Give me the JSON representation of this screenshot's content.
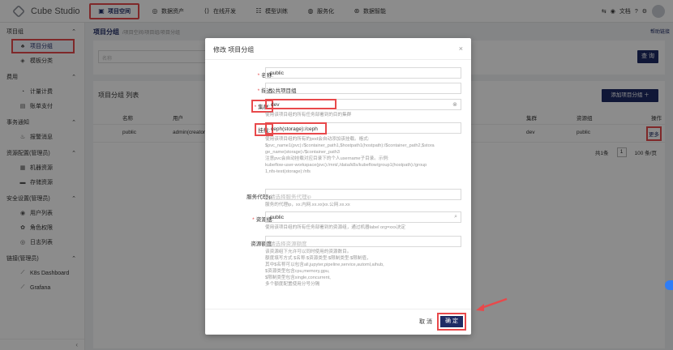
{
  "app": {
    "name": "Cube Studio"
  },
  "nav": [
    {
      "label": "项目空间",
      "icon": "briefcase-icon",
      "active": true
    },
    {
      "label": "数据资产",
      "icon": "database-icon"
    },
    {
      "label": "在线开发",
      "icon": "code-icon"
    },
    {
      "label": "模型训练",
      "icon": "model-icon"
    },
    {
      "label": "服务化",
      "icon": "service-icon"
    },
    {
      "label": "数据智能",
      "icon": "ai-icon"
    }
  ],
  "header_right": {
    "lang": "文档",
    "help": "?"
  },
  "sidebar": {
    "groups": [
      {
        "label": "项目组",
        "items": [
          {
            "label": "项目分组",
            "active": true
          },
          {
            "label": "模板分类"
          }
        ]
      },
      {
        "label": "费用",
        "items": [
          {
            "label": "计量计费"
          },
          {
            "label": "账单支付"
          }
        ]
      },
      {
        "label": "事务通知",
        "items": [
          {
            "label": "报警消息"
          }
        ]
      },
      {
        "label": "资源配置(管理员)",
        "items": [
          {
            "label": "机器资源"
          },
          {
            "label": "存储资源"
          }
        ]
      },
      {
        "label": "安全设置(管理员)",
        "items": [
          {
            "label": "用户列表"
          },
          {
            "label": "角色权限"
          },
          {
            "label": "日志列表"
          }
        ]
      },
      {
        "label": "链接(管理员)",
        "items": [
          {
            "label": "K8s Dashboard"
          },
          {
            "label": "Grafana"
          }
        ]
      }
    ],
    "collapse": "‹"
  },
  "page": {
    "breadcrumb": "项目分组",
    "breadcrumb_sub": "/项目空间/项目组/项目分组",
    "help_link": "帮助链接",
    "search_placeholder": "名称",
    "search_button": "查 询",
    "list_title": "项目分组 列表",
    "add_button": "添加项目分组 ＋",
    "columns": {
      "name": "名称",
      "creator": "用户",
      "cluster": "集群",
      "resource": "资源组",
      "ops": "操作"
    },
    "row": {
      "name": "public",
      "creator": "admin(creator)",
      "cluster": "dev",
      "resource": "public",
      "ops": "更多"
    },
    "pager": {
      "total": "共1条",
      "page": "1",
      "size": "100 条/页"
    }
  },
  "modal": {
    "title": "修改 项目分组",
    "close": "×",
    "fields": {
      "name": {
        "label": "名称:",
        "value": "public"
      },
      "desc": {
        "label": "描述:",
        "value": "公共项目组"
      },
      "cluster": {
        "label": "集群:",
        "value": "dev",
        "help": "使用该项目组的所有任务部署到的目的集群"
      },
      "mount": {
        "label": "挂载:",
        "value": "ceph(storage):/ceph",
        "help": [
          "使用该项目组的所有的pod会自动添加该挂载。格式:",
          "$pvc_name1(pvc):/$container_path1,$hostpath1(hostpath):/$container_path2,$stora",
          "ge_name(storage):/$container_path3",
          "注意pvc会自动挂载对应目录下的个人username子目录。示例:",
          "kubeflow-user-workspace(pvc):/mnt/,/data/k8s/kubeflow/group1(hostpath):/group",
          "1,nfs-test(storage):/nfs"
        ]
      },
      "proxy": {
        "label": "服务代理ip:",
        "placeholder": "请选择服务代理ip",
        "help": "服务的代理ip，xx.内网.xx.xx|xx.公网.xx.xx"
      },
      "resource": {
        "label": "资源组:",
        "value": "public",
        "help": "使用该项目组的所有任务部署到的资源组，通过机器label org=xxx决定"
      },
      "quota": {
        "label": "资源额度:",
        "placeholder": "请选择资源额度",
        "help": [
          "该资源组下允许可以同时使用的资源数目。",
          "额度填写方式 $名称:$资源类型:$限制类型:$限制值，",
          "其中$名称可以包含all,jupyter,pipeline,service,automl,aihub,",
          "$资源类型包含cpu,memory,gpu,",
          "$限制类型包含single,concurrent,",
          "多个额度配置使用分号分隔"
        ]
      }
    },
    "cancel": "取 消",
    "ok": "确 定"
  },
  "colors": {
    "primary": "#1e2b64",
    "highlight": "#e8494b",
    "accent": "#2f7df6"
  }
}
